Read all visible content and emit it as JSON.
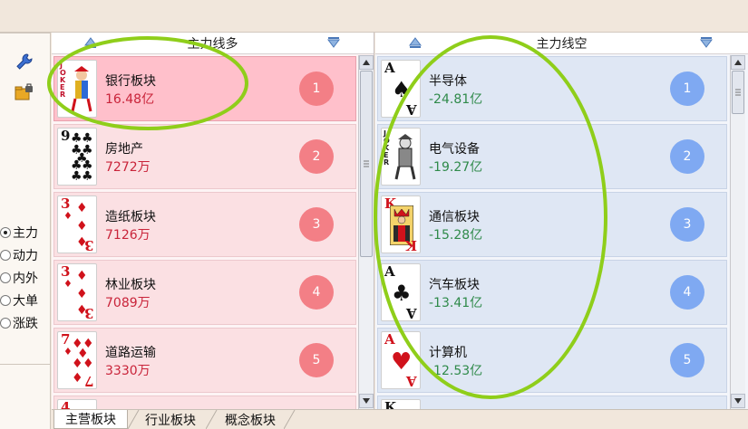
{
  "left_toolbar": {
    "tools": [
      {
        "icon": "wrench-icon"
      },
      {
        "icon": "folder-lock-icon"
      }
    ],
    "radio_options": [
      {
        "label": "主力",
        "checked": true
      },
      {
        "label": "动力",
        "checked": false
      },
      {
        "label": "内外",
        "checked": false
      },
      {
        "label": "大单",
        "checked": false
      },
      {
        "label": "涨跌",
        "checked": false
      }
    ]
  },
  "bullish_panel": {
    "title": "主力线多",
    "rows": [
      {
        "card_rank": "JOKER",
        "card_suit": "joker",
        "name": "银行板块",
        "value": "16.48亿",
        "rank": "1",
        "selected": true
      },
      {
        "card_rank": "9",
        "card_suit": "clubs",
        "name": "房地产",
        "value": "7272万",
        "rank": "2",
        "selected": false
      },
      {
        "card_rank": "3",
        "card_suit": "diamonds",
        "name": "造纸板块",
        "value": "7126万",
        "rank": "3",
        "selected": false
      },
      {
        "card_rank": "3",
        "card_suit": "diamonds",
        "name": "林业板块",
        "value": "7089万",
        "rank": "4",
        "selected": false
      },
      {
        "card_rank": "7",
        "card_suit": "diamonds",
        "name": "道路运输",
        "value": "3330万",
        "rank": "5",
        "selected": false
      }
    ],
    "partial_next_card_rank": "4"
  },
  "bearish_panel": {
    "title": "主力线空",
    "rows": [
      {
        "card_rank": "A",
        "card_suit": "spades",
        "name": "半导体",
        "value": "-24.81亿",
        "rank": "1"
      },
      {
        "card_rank": "JOKER",
        "card_suit": "joker",
        "name": "电气设备",
        "value": "-19.27亿",
        "rank": "2"
      },
      {
        "card_rank": "K",
        "card_suit": "diamonds",
        "name": "通信板块",
        "value": "-15.28亿",
        "rank": "3"
      },
      {
        "card_rank": "A",
        "card_suit": "clubs",
        "name": "汽车板块",
        "value": "-13.41亿",
        "rank": "4"
      },
      {
        "card_rank": "A",
        "card_suit": "hearts",
        "name": "计算机",
        "value": "-12.53亿",
        "rank": "5"
      }
    ],
    "partial_next_card_rank": "K"
  },
  "bottom_tabs": [
    {
      "label": "主营板块",
      "active": true
    },
    {
      "label": "行业板块",
      "active": false
    },
    {
      "label": "概念板块",
      "active": false
    }
  ],
  "colors": {
    "bull_badge": "#f37f86",
    "bear_badge": "#7fa9f2",
    "bull_value": "#c9243a",
    "bear_value": "#2f8a4a",
    "highlight_ring": "#8fce1a"
  }
}
